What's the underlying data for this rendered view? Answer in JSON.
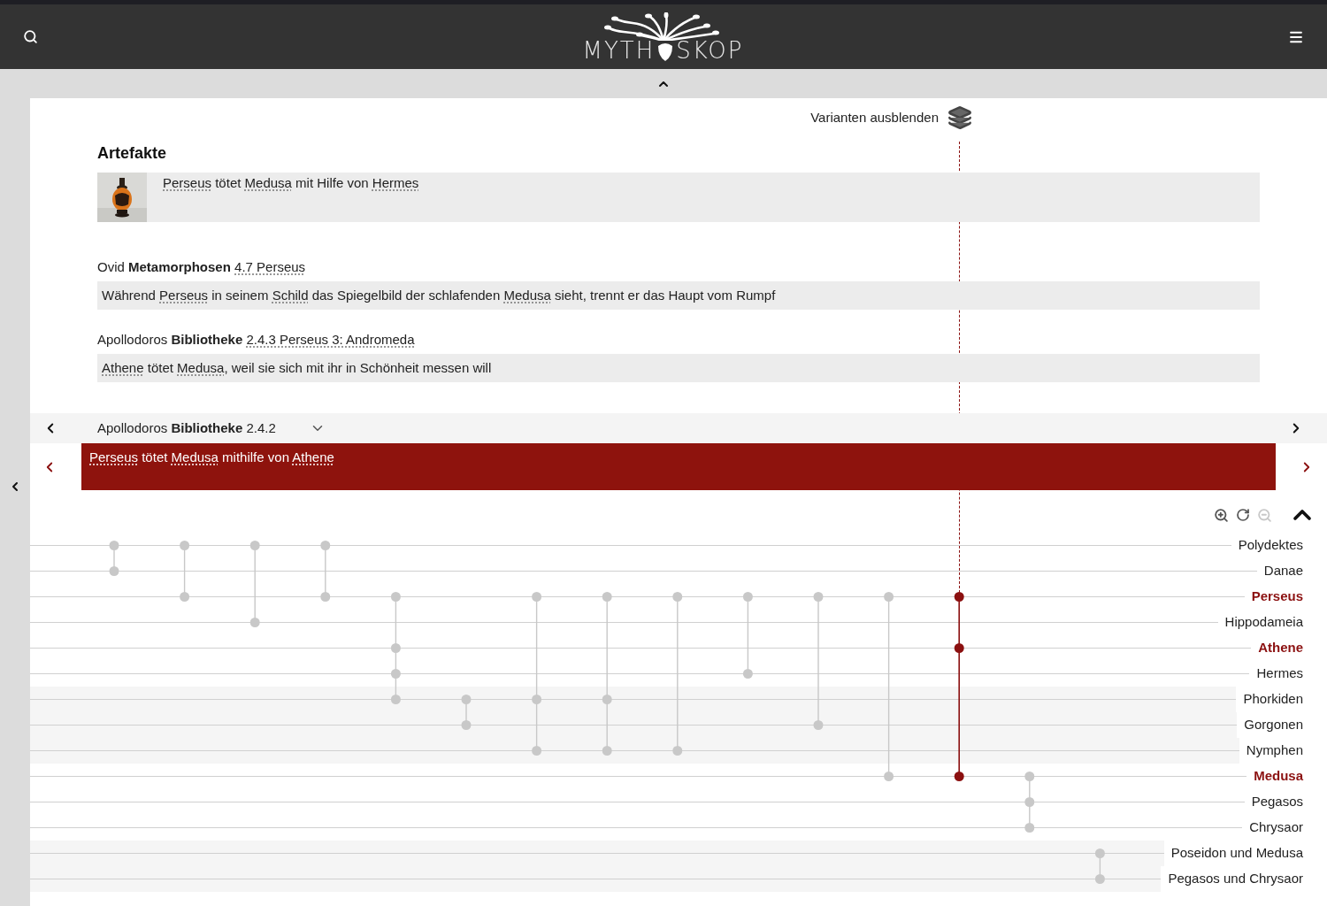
{
  "header": {
    "logo": {
      "left": "MYTH",
      "right": "SKOP"
    }
  },
  "variants_toggle": {
    "label": "Varianten ausblenden"
  },
  "artifacts": {
    "heading": "Artefakte",
    "items": [
      {
        "kind": "picture",
        "caption": [
          {
            "t": "Perseus",
            "kind": "link"
          },
          {
            "t": " tötet ",
            "kind": "plain"
          },
          {
            "t": "Medusa",
            "kind": "link"
          },
          {
            "t": " mit Hilfe von ",
            "kind": "plain"
          },
          {
            "t": "Hermes",
            "kind": "link"
          }
        ]
      }
    ]
  },
  "sources": [
    {
      "citation": [
        {
          "t": "Ovid ",
          "kind": "plain"
        },
        {
          "t": "Metamorphosen",
          "kind": "bold"
        },
        {
          "t": "4.7 Perseus",
          "kind": "link"
        }
      ],
      "excerpt": [
        {
          "t": "Während ",
          "kind": "plain"
        },
        {
          "t": "Perseus",
          "kind": "link"
        },
        {
          "t": " in seinem ",
          "kind": "plain"
        },
        {
          "t": "Schild",
          "kind": "link"
        },
        {
          "t": " das Spiegelbild der schlafenden ",
          "kind": "plain"
        },
        {
          "t": "Medusa",
          "kind": "link"
        },
        {
          "t": " sieht, trennt er das Haupt vom Rumpf",
          "kind": "plain"
        }
      ]
    },
    {
      "citation": [
        {
          "t": "Apollodoros ",
          "kind": "plain"
        },
        {
          "t": "Bibliotheke",
          "kind": "bold"
        },
        {
          "t": "2.4.3 Perseus 3: Andromeda",
          "kind": "link"
        }
      ],
      "excerpt": [
        {
          "t": "Athene",
          "kind": "link"
        },
        {
          "t": " tötet ",
          "kind": "plain"
        },
        {
          "t": "Medusa",
          "kind": "link"
        },
        {
          "t": ", weil sie sich mit ihr in Schönheit messen will",
          "kind": "plain"
        }
      ]
    }
  ],
  "navigator": {
    "citation": [
      {
        "t": "Apollodoros ",
        "kind": "plain"
      },
      {
        "t": "Bibliotheke",
        "kind": "bold"
      },
      {
        "t": " 2.4.2",
        "kind": "plain"
      }
    ]
  },
  "selected_event": {
    "text": [
      {
        "t": "Perseus",
        "kind": "link"
      },
      {
        "t": " tötet ",
        "kind": "plain"
      },
      {
        "t": "Medusa",
        "kind": "link"
      },
      {
        "t": " mithilfe von ",
        "kind": "plain"
      },
      {
        "t": "Athene",
        "kind": "link"
      }
    ]
  },
  "graph": {
    "controls": [
      {
        "kind": "zoom-in",
        "disabled": false
      },
      {
        "kind": "reset",
        "disabled": false
      },
      {
        "kind": "zoom-out",
        "disabled": true
      },
      {
        "kind": "collapse",
        "disabled": false
      }
    ],
    "events": [
      {
        "selected": false
      },
      {
        "selected": false
      },
      {
        "selected": false
      },
      {
        "selected": false
      },
      {
        "selected": false
      },
      {
        "selected": false
      },
      {
        "selected": false
      },
      {
        "selected": false
      },
      {
        "selected": false
      },
      {
        "selected": false
      },
      {
        "selected": false
      },
      {
        "selected": false
      },
      {
        "selected": true
      },
      {
        "selected": false
      },
      {
        "selected": false
      }
    ],
    "lanes": [
      {
        "name": "Polydektes",
        "highlighted": false,
        "grouped": false,
        "slots": [
          {
            "kind": "dot"
          },
          {
            "kind": "dot"
          },
          {
            "kind": "dot"
          },
          {
            "kind": "dot"
          },
          {
            "kind": "empty"
          },
          {
            "kind": "empty"
          },
          {
            "kind": "empty"
          },
          {
            "kind": "empty"
          },
          {
            "kind": "empty"
          },
          {
            "kind": "empty"
          },
          {
            "kind": "empty"
          },
          {
            "kind": "empty"
          },
          {
            "kind": "empty"
          },
          {
            "kind": "empty"
          },
          {
            "kind": "empty"
          }
        ]
      },
      {
        "name": "Danae",
        "highlighted": false,
        "grouped": false,
        "slots": [
          {
            "kind": "dot"
          },
          {
            "kind": "empty"
          },
          {
            "kind": "empty"
          },
          {
            "kind": "empty"
          },
          {
            "kind": "empty"
          },
          {
            "kind": "empty"
          },
          {
            "kind": "empty"
          },
          {
            "kind": "empty"
          },
          {
            "kind": "empty"
          },
          {
            "kind": "empty"
          },
          {
            "kind": "empty"
          },
          {
            "kind": "empty"
          },
          {
            "kind": "empty"
          },
          {
            "kind": "empty"
          },
          {
            "kind": "empty"
          }
        ]
      },
      {
        "name": "Perseus",
        "highlighted": true,
        "grouped": false,
        "slots": [
          {
            "kind": "empty"
          },
          {
            "kind": "dot"
          },
          {
            "kind": "empty"
          },
          {
            "kind": "dot"
          },
          {
            "kind": "dot"
          },
          {
            "kind": "empty"
          },
          {
            "kind": "dot"
          },
          {
            "kind": "dot"
          },
          {
            "kind": "dot"
          },
          {
            "kind": "dot"
          },
          {
            "kind": "dot"
          },
          {
            "kind": "dot"
          },
          {
            "kind": "dot"
          },
          {
            "kind": "empty"
          },
          {
            "kind": "empty"
          }
        ]
      },
      {
        "name": "Hippodameia",
        "highlighted": false,
        "grouped": false,
        "slots": [
          {
            "kind": "empty"
          },
          {
            "kind": "empty"
          },
          {
            "kind": "dot"
          },
          {
            "kind": "empty"
          },
          {
            "kind": "empty"
          },
          {
            "kind": "empty"
          },
          {
            "kind": "empty"
          },
          {
            "kind": "empty"
          },
          {
            "kind": "empty"
          },
          {
            "kind": "empty"
          },
          {
            "kind": "empty"
          },
          {
            "kind": "empty"
          },
          {
            "kind": "empty"
          },
          {
            "kind": "empty"
          },
          {
            "kind": "empty"
          }
        ]
      },
      {
        "name": "Athene",
        "highlighted": true,
        "grouped": false,
        "slots": [
          {
            "kind": "empty"
          },
          {
            "kind": "empty"
          },
          {
            "kind": "empty"
          },
          {
            "kind": "empty"
          },
          {
            "kind": "dot"
          },
          {
            "kind": "empty"
          },
          {
            "kind": "empty"
          },
          {
            "kind": "empty"
          },
          {
            "kind": "empty"
          },
          {
            "kind": "empty"
          },
          {
            "kind": "empty"
          },
          {
            "kind": "empty"
          },
          {
            "kind": "dot"
          },
          {
            "kind": "empty"
          },
          {
            "kind": "empty"
          }
        ]
      },
      {
        "name": "Hermes",
        "highlighted": false,
        "grouped": false,
        "slots": [
          {
            "kind": "empty"
          },
          {
            "kind": "empty"
          },
          {
            "kind": "empty"
          },
          {
            "kind": "empty"
          },
          {
            "kind": "dot"
          },
          {
            "kind": "empty"
          },
          {
            "kind": "empty"
          },
          {
            "kind": "empty"
          },
          {
            "kind": "empty"
          },
          {
            "kind": "dot"
          },
          {
            "kind": "empty"
          },
          {
            "kind": "empty"
          },
          {
            "kind": "empty"
          },
          {
            "kind": "empty"
          },
          {
            "kind": "empty"
          }
        ]
      },
      {
        "name": "Phorkiden",
        "highlighted": false,
        "grouped": true,
        "slots": [
          {
            "kind": "empty"
          },
          {
            "kind": "empty"
          },
          {
            "kind": "empty"
          },
          {
            "kind": "empty"
          },
          {
            "kind": "dot"
          },
          {
            "kind": "dot"
          },
          {
            "kind": "dot"
          },
          {
            "kind": "dot"
          },
          {
            "kind": "empty"
          },
          {
            "kind": "empty"
          },
          {
            "kind": "empty"
          },
          {
            "kind": "empty"
          },
          {
            "kind": "empty"
          },
          {
            "kind": "empty"
          },
          {
            "kind": "empty"
          }
        ]
      },
      {
        "name": "Gorgonen",
        "highlighted": false,
        "grouped": true,
        "slots": [
          {
            "kind": "empty"
          },
          {
            "kind": "empty"
          },
          {
            "kind": "empty"
          },
          {
            "kind": "empty"
          },
          {
            "kind": "empty"
          },
          {
            "kind": "dot"
          },
          {
            "kind": "empty"
          },
          {
            "kind": "empty"
          },
          {
            "kind": "empty"
          },
          {
            "kind": "empty"
          },
          {
            "kind": "dot"
          },
          {
            "kind": "empty"
          },
          {
            "kind": "empty"
          },
          {
            "kind": "empty"
          },
          {
            "kind": "empty"
          }
        ]
      },
      {
        "name": "Nymphen",
        "highlighted": false,
        "grouped": true,
        "slots": [
          {
            "kind": "empty"
          },
          {
            "kind": "empty"
          },
          {
            "kind": "empty"
          },
          {
            "kind": "empty"
          },
          {
            "kind": "empty"
          },
          {
            "kind": "empty"
          },
          {
            "kind": "dot"
          },
          {
            "kind": "dot"
          },
          {
            "kind": "dot"
          },
          {
            "kind": "empty"
          },
          {
            "kind": "empty"
          },
          {
            "kind": "empty"
          },
          {
            "kind": "empty"
          },
          {
            "kind": "empty"
          },
          {
            "kind": "empty"
          }
        ]
      },
      {
        "name": "Medusa",
        "highlighted": true,
        "grouped": false,
        "slots": [
          {
            "kind": "empty"
          },
          {
            "kind": "empty"
          },
          {
            "kind": "empty"
          },
          {
            "kind": "empty"
          },
          {
            "kind": "empty"
          },
          {
            "kind": "empty"
          },
          {
            "kind": "empty"
          },
          {
            "kind": "empty"
          },
          {
            "kind": "empty"
          },
          {
            "kind": "empty"
          },
          {
            "kind": "empty"
          },
          {
            "kind": "dot"
          },
          {
            "kind": "dot"
          },
          {
            "kind": "dot"
          },
          {
            "kind": "empty"
          }
        ]
      },
      {
        "name": "Pegasos",
        "highlighted": false,
        "grouped": false,
        "slots": [
          {
            "kind": "empty"
          },
          {
            "kind": "empty"
          },
          {
            "kind": "empty"
          },
          {
            "kind": "empty"
          },
          {
            "kind": "empty"
          },
          {
            "kind": "empty"
          },
          {
            "kind": "empty"
          },
          {
            "kind": "empty"
          },
          {
            "kind": "empty"
          },
          {
            "kind": "empty"
          },
          {
            "kind": "empty"
          },
          {
            "kind": "empty"
          },
          {
            "kind": "empty"
          },
          {
            "kind": "dot"
          },
          {
            "kind": "empty"
          }
        ]
      },
      {
        "name": "Chrysaor",
        "highlighted": false,
        "grouped": false,
        "slots": [
          {
            "kind": "empty"
          },
          {
            "kind": "empty"
          },
          {
            "kind": "empty"
          },
          {
            "kind": "empty"
          },
          {
            "kind": "empty"
          },
          {
            "kind": "empty"
          },
          {
            "kind": "empty"
          },
          {
            "kind": "empty"
          },
          {
            "kind": "empty"
          },
          {
            "kind": "empty"
          },
          {
            "kind": "empty"
          },
          {
            "kind": "empty"
          },
          {
            "kind": "empty"
          },
          {
            "kind": "dot"
          },
          {
            "kind": "empty"
          }
        ]
      },
      {
        "name": "Poseidon und Medusa",
        "highlighted": false,
        "grouped": true,
        "slots": [
          {
            "kind": "empty"
          },
          {
            "kind": "empty"
          },
          {
            "kind": "empty"
          },
          {
            "kind": "empty"
          },
          {
            "kind": "empty"
          },
          {
            "kind": "empty"
          },
          {
            "kind": "empty"
          },
          {
            "kind": "empty"
          },
          {
            "kind": "empty"
          },
          {
            "kind": "empty"
          },
          {
            "kind": "empty"
          },
          {
            "kind": "empty"
          },
          {
            "kind": "empty"
          },
          {
            "kind": "empty"
          },
          {
            "kind": "dot"
          }
        ]
      },
      {
        "name": "Pegasos und Chrysaor",
        "highlighted": false,
        "grouped": true,
        "slots": [
          {
            "kind": "empty"
          },
          {
            "kind": "empty"
          },
          {
            "kind": "empty"
          },
          {
            "kind": "empty"
          },
          {
            "kind": "empty"
          },
          {
            "kind": "empty"
          },
          {
            "kind": "empty"
          },
          {
            "kind": "empty"
          },
          {
            "kind": "empty"
          },
          {
            "kind": "empty"
          },
          {
            "kind": "empty"
          },
          {
            "kind": "empty"
          },
          {
            "kind": "empty"
          },
          {
            "kind": "empty"
          },
          {
            "kind": "dot"
          }
        ]
      }
    ]
  }
}
